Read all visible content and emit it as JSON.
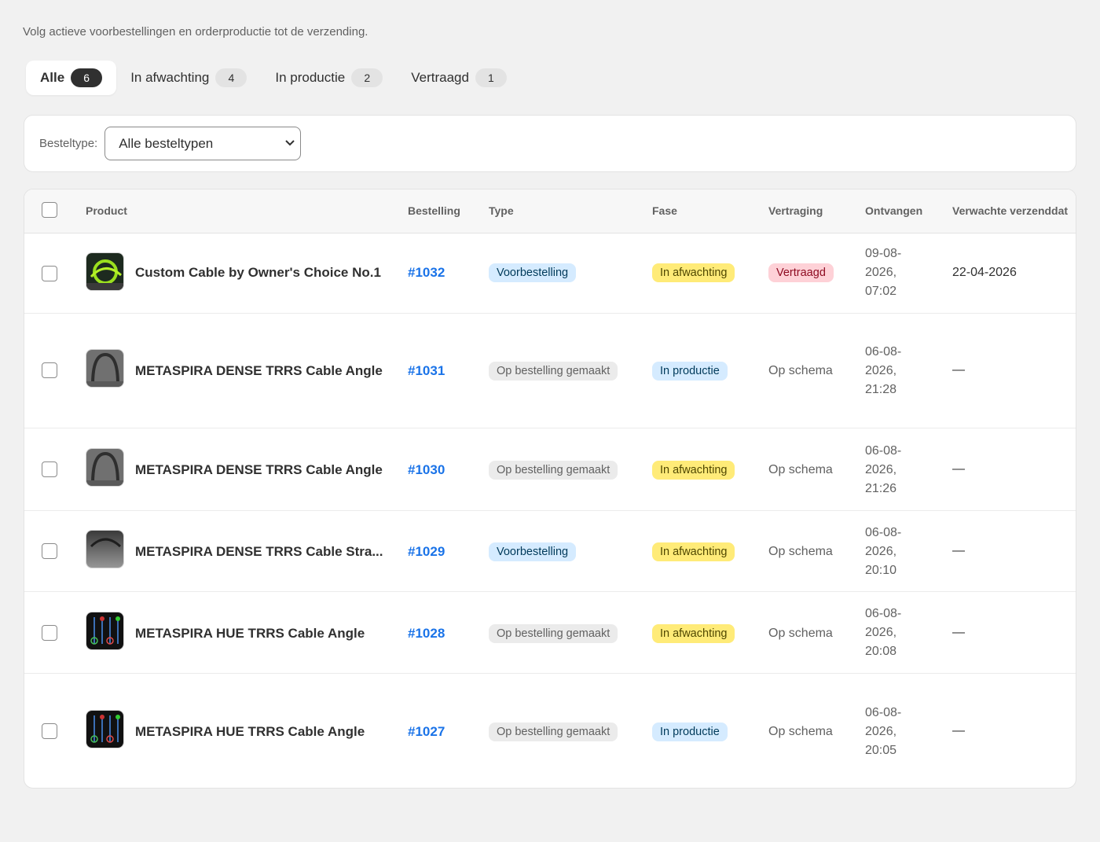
{
  "subtitle": "Volg actieve voorbestellingen en orderproductie tot de verzending.",
  "tabs": [
    {
      "label": "Alle",
      "count": "6"
    },
    {
      "label": "In afwachting",
      "count": "4"
    },
    {
      "label": "In productie",
      "count": "2"
    },
    {
      "label": "Vertraagd",
      "count": "1"
    }
  ],
  "filter": {
    "label": "Besteltype:",
    "selected": "Alle besteltypen"
  },
  "columns": {
    "product": "Product",
    "order": "Bestelling",
    "type": "Type",
    "phase": "Fase",
    "delay": "Vertraging",
    "received": "Ontvangen",
    "expected": "Verwachte verzenddat"
  },
  "rows": [
    {
      "product": "Custom Cable by Owner's Choice No.1",
      "order": "#1032",
      "type": "Voorbestelling",
      "phase": "In afwachting",
      "delay": "Vertraagd",
      "received": "09-08-2026, 07:02",
      "expected": "22-04-2026"
    },
    {
      "product": "METASPIRA DENSE TRRS Cable Angle",
      "order": "#1031",
      "type": "Op bestelling gemaakt",
      "phase": "In productie",
      "delay": "Op schema",
      "received": "06-08-2026, 21:28",
      "expected": "—"
    },
    {
      "product": "METASPIRA DENSE TRRS Cable Angle",
      "order": "#1030",
      "type": "Op bestelling gemaakt",
      "phase": "In afwachting",
      "delay": "Op schema",
      "received": "06-08-2026, 21:26",
      "expected": "—"
    },
    {
      "product": "METASPIRA DENSE TRRS Cable Stra...",
      "order": "#1029",
      "type": "Voorbestelling",
      "phase": "In afwachting",
      "delay": "Op schema",
      "received": "06-08-2026, 20:10",
      "expected": "—"
    },
    {
      "product": "METASPIRA HUE TRRS Cable Angle",
      "order": "#1028",
      "type": "Op bestelling gemaakt",
      "phase": "In afwachting",
      "delay": "Op schema",
      "received": "06-08-2026, 20:08",
      "expected": "—"
    },
    {
      "product": "METASPIRA HUE TRRS Cable Angle",
      "order": "#1027",
      "type": "Op bestelling gemaakt",
      "phase": "In productie",
      "delay": "Op schema",
      "received": "06-08-2026, 20:05",
      "expected": "—"
    }
  ]
}
